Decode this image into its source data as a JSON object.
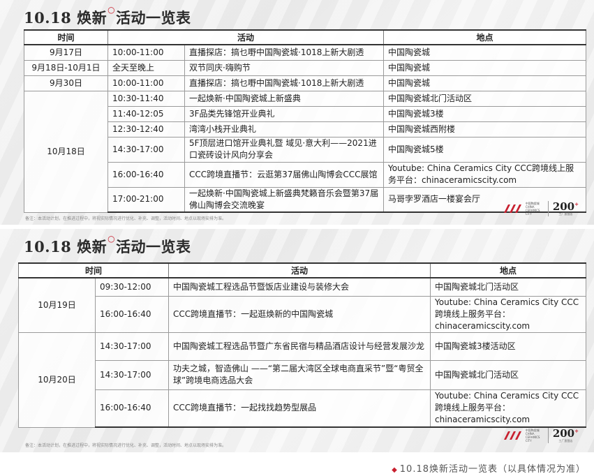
{
  "panel1": {
    "title_main": "10.18 焕新",
    "title_ring": "○",
    "title_rest": "活动一览表",
    "headers": {
      "time": "时间",
      "activity": "活动",
      "location": "地点"
    },
    "rows": [
      {
        "date": "9月17日",
        "time": "10:00-11:00",
        "activity": "直播探店：搞乜嘢中国陶瓷城·1018上新大剧透",
        "location": "中国陶瓷城"
      },
      {
        "date": "9月18日-10月1日",
        "time": "全天至晚上",
        "activity": "双节同庆·嗨购节",
        "location": "中国陶瓷城"
      },
      {
        "date": "9月30日",
        "time": "10:00-11:00",
        "activity": "直播探店：搞乜嘢中国陶瓷城·1018上新大剧透",
        "location": "中国陶瓷城"
      },
      {
        "date": "10月18日",
        "time": "10:30-11:40",
        "activity": "一起焕新·中国陶瓷城上新盛典",
        "location": "中国陶瓷城北门活动区"
      },
      {
        "time": "11:40-12:05",
        "activity": "3F品类先锋馆开业典礼",
        "location": "中国陶瓷城3楼"
      },
      {
        "time": "12:30-12:40",
        "activity": "湾湾小栈开业典礼",
        "location": "中国陶瓷城西附楼"
      },
      {
        "time": "14:30-17:00",
        "activity": "5F顶层进口馆开业典礼暨 域见·意大利——2021进口瓷砖设计风向分享会",
        "location": "中国陶瓷城5楼"
      },
      {
        "time": "16:00-16:40",
        "activity": "CCC跨境直播节：云逛第37届佛山陶博会CCC展馆",
        "location": "Youtube: China Ceramics City CCC跨境线上服务平台：chinaceramicscity.com"
      },
      {
        "time": "17:00-21:00",
        "activity": "一起焕新·中国陶瓷城上新盛典梵籁音乐会暨第37届佛山陶博会交流晚宴",
        "location": "马哥孛罗酒店一楼宴会厅"
      }
    ],
    "note": "备注：本活动计划，在推进过程中，将视实际情况进行优化、补充、调整，活动时间、地点以现场安排为准。",
    "logo_name": "中国陶瓷城 CHINA CERAMICS CITY",
    "badge_num": "200",
    "badge_sup": "+",
    "badge_sub": "工厂直营店"
  },
  "panel2": {
    "title_main": "10.18 焕新",
    "title_ring": "○",
    "title_rest": "活动一览表",
    "headers": {
      "time": "时间",
      "activity": "活动",
      "location": "地点"
    },
    "rows": [
      {
        "date": "10月19日",
        "time": "09:30-12:00",
        "activity": "中国陶瓷城工程选品节暨饭店业建设与装修大会",
        "location": "中国陶瓷城北门活动区"
      },
      {
        "time": "16:00-16:40",
        "activity": "CCC跨境直播节：一起逛焕新的中国陶瓷城",
        "location": "Youtube: China Ceramics City CCC跨境线上服务平台：chinaceramicscity.com"
      },
      {
        "date": "10月20日",
        "time": "14:30-17:00",
        "activity": "中国陶瓷城工程选品节暨广东省民宿与精品酒店设计与经营发展沙龙",
        "location": "中国陶瓷城3楼活动区"
      },
      {
        "time": "14:30-17:00",
        "activity": "功夫之城，智造佛山 ——“第二届大湾区全球电商直采节”暨“粤贸全球”跨境电商选品大会",
        "location": "中国陶瓷城北门活动区"
      },
      {
        "time": "16:00-16:40",
        "activity": "CCC跨境直播节：一起找找趋势型展品",
        "location": "Youtube: China Ceramics City CCC跨境线上服务平台：chinaceramicscity.com"
      }
    ],
    "note": "备注：本活动计划，在推进过程中，将视实际情况进行优化、补充、调整，活动时间、地点以现场安排为准。",
    "logo_name": "中国陶瓷城 CHINA CERAMICS CITY",
    "badge_num": "200",
    "badge_sup": "+",
    "badge_sub": "工厂直营店"
  },
  "caption": "10.18焕新活动一览表（以具体情况为准）",
  "caption_mark": "◆",
  "colors": {
    "accent_red": "#c8202f",
    "text": "#222222",
    "rule": "#333333"
  }
}
